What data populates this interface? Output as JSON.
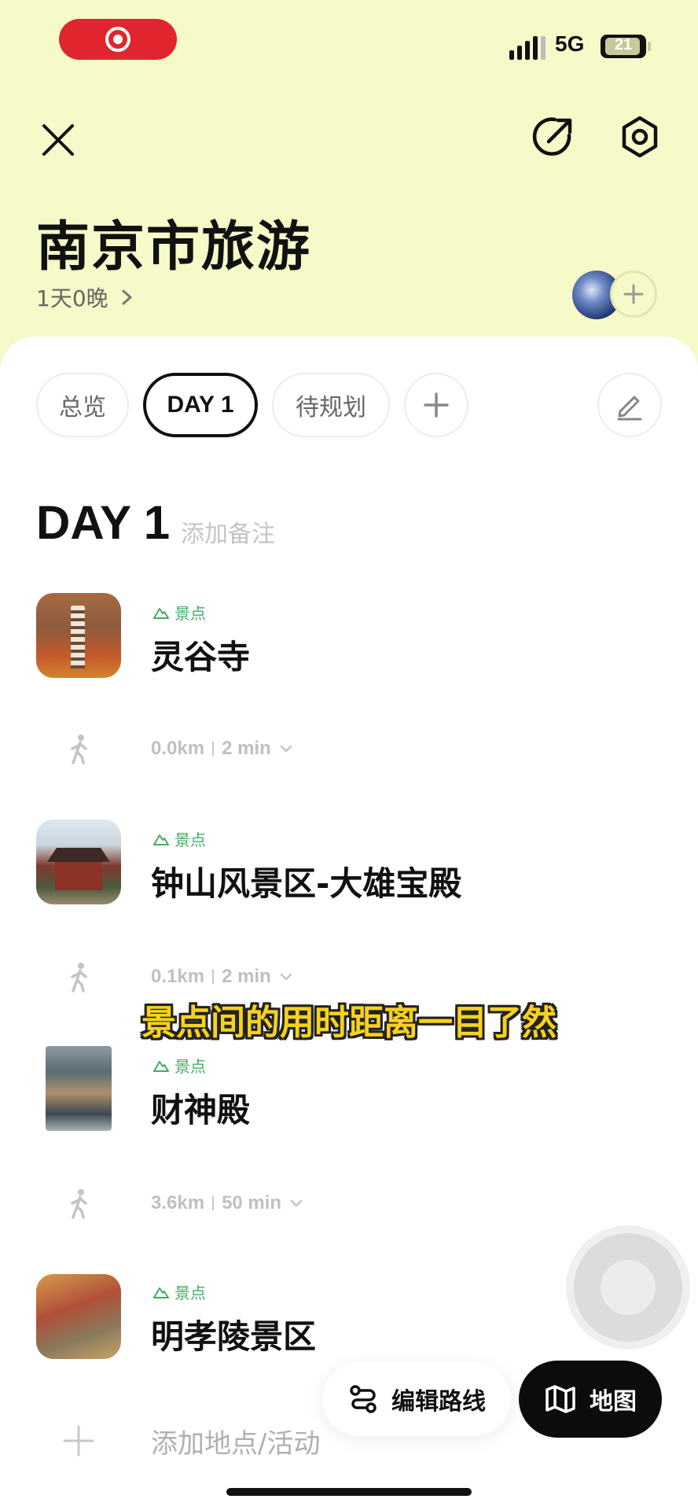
{
  "status_bar": {
    "network": "5G",
    "battery": "21"
  },
  "trip": {
    "title": "南京市旅游",
    "duration": "1天0晚"
  },
  "tabs": [
    {
      "label": "总览",
      "active": false
    },
    {
      "label": "DAY 1",
      "active": true
    },
    {
      "label": "待规划",
      "active": false
    }
  ],
  "day": {
    "heading": "DAY 1",
    "note_placeholder": "添加备注"
  },
  "places": [
    {
      "category": "景点",
      "name": "灵谷寺"
    },
    {
      "category": "景点",
      "name": "钟山风景区-大雄宝殿"
    },
    {
      "category": "景点",
      "name": "财神殿"
    },
    {
      "category": "景点",
      "name": "明孝陵景区"
    }
  ],
  "legs": [
    {
      "distance": "0.0km",
      "duration": "2 min"
    },
    {
      "distance": "0.1km",
      "duration": "2 min"
    },
    {
      "distance": "3.6km",
      "duration": "50 min"
    }
  ],
  "caption": "景点间的用时距离一目了然",
  "actions": {
    "add_place": "添加地点/活动",
    "edit_route": "编辑路线",
    "map": "地图"
  },
  "colors": {
    "header_bg": "#f6f9c8",
    "tag_green": "#3fae63",
    "caption_yellow": "#f7d21b",
    "record_red": "#e0252f"
  },
  "icons": [
    "record-icon",
    "close-icon",
    "share-icon",
    "settings-icon",
    "chevron-right-icon",
    "plus-icon",
    "pencil-icon",
    "mountain-icon",
    "walk-icon",
    "chevron-down-icon",
    "route-icon",
    "map-icon"
  ]
}
